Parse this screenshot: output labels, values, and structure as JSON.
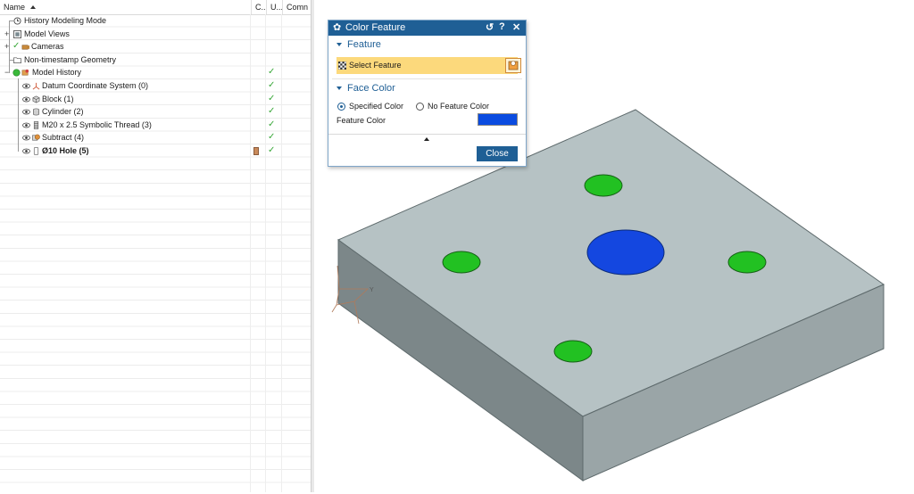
{
  "navigator": {
    "columns": {
      "name": "Name",
      "c": "C...",
      "u": "U...",
      "comments": "Comn"
    },
    "rows": [
      {
        "label": "History Modeling Mode",
        "icon": "clock-icon",
        "checked": false
      },
      {
        "label": "Model Views",
        "icon": "model-view-icon",
        "expander": "+",
        "checked": false
      },
      {
        "label": "Cameras",
        "icon": "camera-icon",
        "expander": "+",
        "checked": false
      },
      {
        "label": "Non-timestamp Geometry",
        "icon": "folder-icon",
        "checked": false
      },
      {
        "label": "Model History",
        "icon": "history-icon",
        "expander": "−",
        "checked": true
      },
      {
        "label": "Datum Coordinate System (0)",
        "icon": "datum-csys-icon",
        "checked": true
      },
      {
        "label": "Block (1)",
        "icon": "block-icon",
        "checked": true
      },
      {
        "label": "Cylinder (2)",
        "icon": "cylinder-icon",
        "checked": true
      },
      {
        "label": "M20 x 2.5 Symbolic Thread (3)",
        "icon": "thread-icon",
        "checked": true
      },
      {
        "label": "Subtract (4)",
        "icon": "subtract-icon",
        "checked": true
      },
      {
        "label": "Ø10 Hole (5)",
        "icon": "hole-icon",
        "checked": true,
        "bold": true
      }
    ]
  },
  "dialog": {
    "title": "Color Feature",
    "buttons": {
      "reset": "↺",
      "help": "?",
      "close": "✕"
    },
    "feature_section": "Feature",
    "select_feature": "Select Feature",
    "face_color_section": "Face Color",
    "specified_color": "Specified Color",
    "no_feature_color": "No Feature Color",
    "feature_color_label": "Feature Color",
    "close_button": "Close"
  },
  "colors": {
    "accent": "#1f5f95",
    "feature_color": "#0a4be0",
    "select_highlight": "#fcd97c",
    "body_top": "#b6c2c4",
    "body_front": "#7c8789",
    "body_side": "#9aa5a7",
    "hole_green": "#22c122",
    "hole_blue": "#1447e0"
  },
  "viewport": {
    "triad_label": "Y"
  }
}
